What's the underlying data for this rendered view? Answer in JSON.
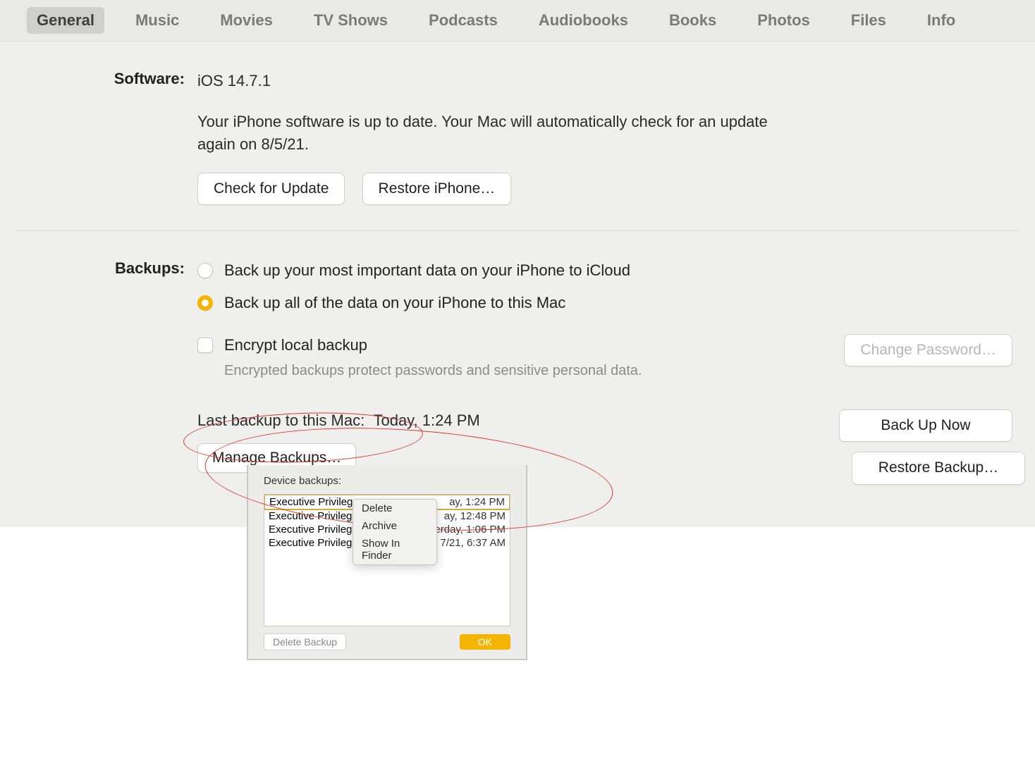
{
  "tabs": [
    "General",
    "Music",
    "Movies",
    "TV Shows",
    "Podcasts",
    "Audiobooks",
    "Books",
    "Photos",
    "Files",
    "Info"
  ],
  "active_tab_index": 0,
  "software": {
    "label": "Software:",
    "version": "iOS 14.7.1",
    "desc": "Your iPhone software is up to date. Your Mac will automatically check for an update again on 8/5/21.",
    "check_btn": "Check for Update",
    "restore_btn": "Restore iPhone…"
  },
  "backups": {
    "label": "Backups:",
    "opt_icloud": "Back up your most important data on your iPhone to iCloud",
    "opt_mac": "Back up all of the data on your iPhone to this Mac",
    "selected": "mac",
    "encrypt_label": "Encrypt local backup",
    "encrypt_desc": "Encrypted backups protect passwords and sensitive personal data.",
    "change_pw_btn": "Change Password…",
    "last_backup_label": "Last backup to this Mac:",
    "last_backup_value": "Today, 1:24 PM",
    "manage_btn": "Manage Backups…",
    "backup_now_btn": "Back Up Now",
    "restore_backup_btn": "Restore Backup…"
  },
  "popup": {
    "title": "Device backups:",
    "rows": [
      {
        "name": "Executive Privilege",
        "time": "ay, 1:24 PM"
      },
      {
        "name": "Executive Privilege",
        "time": "ay, 12:48 PM"
      },
      {
        "name": "Executive Privilege",
        "time": "terday, 1:06 PM"
      },
      {
        "name": "Executive Privilege",
        "time": "7/21, 6:37 AM"
      }
    ],
    "delete_btn": "Delete Backup",
    "ok_btn": "OK"
  },
  "ctx": {
    "delete": "Delete",
    "archive": "Archive",
    "show": "Show In Finder"
  }
}
